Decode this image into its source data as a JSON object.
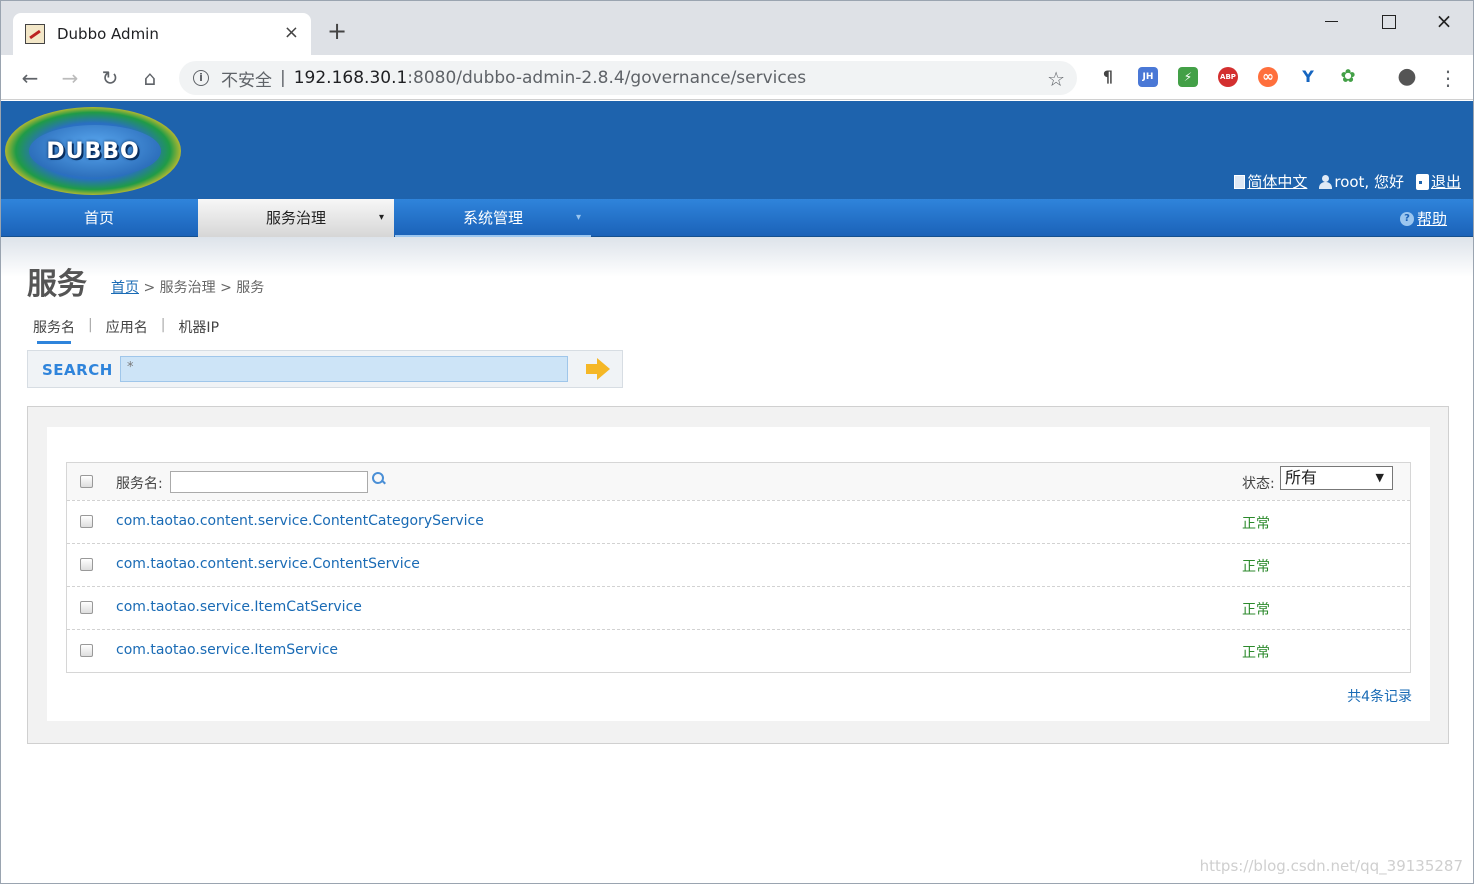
{
  "browser": {
    "tab_title": "Dubbo Admin",
    "close_glyph": "×",
    "new_tab_glyph": "+",
    "back_glyph": "←",
    "forward_glyph": "→",
    "reload_glyph": "↻",
    "home_glyph": "⌂",
    "info_glyph": "i",
    "star_glyph": "☆",
    "menu_glyph": "⋮",
    "insecure_label": "不安全",
    "url_sep": "|",
    "url_host": "192.168.30.1",
    "url_path": ":8080/dubbo-admin-2.8.4/governance/services",
    "extensions": [
      {
        "icon": "paragraph-icon",
        "label": "¶",
        "color": "#444444"
      },
      {
        "icon": "jh-icon",
        "label": "JH",
        "color": "#4a78d6"
      },
      {
        "icon": "bolt-icon",
        "label": "⚡",
        "color": "#e84b2b"
      },
      {
        "icon": "abp-icon",
        "label": "ABP",
        "color": "#d32f2f"
      },
      {
        "icon": "infinity-icon",
        "label": "∞",
        "color": "#ff6f3c"
      },
      {
        "icon": "y-icon",
        "label": "Y",
        "color": "#1565c0"
      },
      {
        "icon": "puzzle-icon",
        "label": "✿",
        "color": "#43a047"
      },
      {
        "icon": "profile-icon",
        "label": "●",
        "color": "#555555"
      }
    ]
  },
  "app": {
    "logo_text": "DUBBO",
    "header_links": {
      "language": "简体中文",
      "user": "root, 您好",
      "logout": "退出"
    },
    "menu": [
      {
        "label": "首页",
        "active": false
      },
      {
        "label": "服务治理",
        "active": true,
        "caret": "▾"
      },
      {
        "label": "系统管理",
        "active": false,
        "caret": "▾"
      }
    ],
    "help_glyph": "?",
    "help_label": "帮助",
    "accent_color": "#1e63ad"
  },
  "page": {
    "title": "服务",
    "breadcrumb": {
      "home": "首页",
      "sep1": " > ",
      "section": "服务治理",
      "sep2": " > ",
      "current": "服务"
    },
    "subtabs": [
      {
        "label": "服务名",
        "active": true
      },
      {
        "label": "应用名",
        "active": false
      },
      {
        "label": "机器IP",
        "active": false
      }
    ],
    "subtab_sep": "|",
    "search": {
      "label": "SEARCH",
      "value": "*"
    }
  },
  "table": {
    "filter_label": "服务名:",
    "status_label": "状态:",
    "status_value": "所有",
    "status_arrow": "▼",
    "rows": [
      {
        "service": "com.taotao.content.service.ContentCategoryService",
        "status": "正常"
      },
      {
        "service": "com.taotao.content.service.ContentService",
        "status": "正常"
      },
      {
        "service": "com.taotao.service.ItemCatService",
        "status": "正常"
      },
      {
        "service": "com.taotao.service.ItemService",
        "status": "正常"
      }
    ],
    "total": "共4条记录"
  },
  "watermark": "https://blog.csdn.net/qq_39135287"
}
